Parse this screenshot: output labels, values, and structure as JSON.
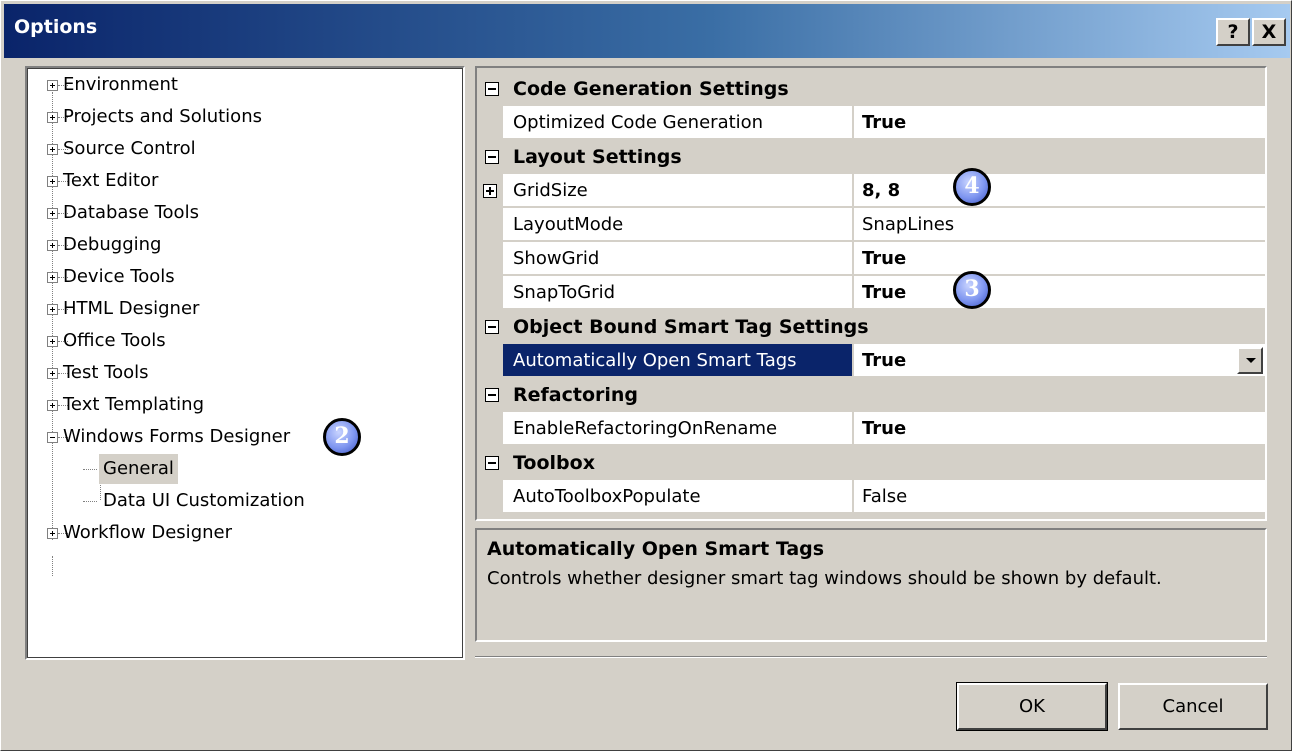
{
  "window": {
    "title": "Options"
  },
  "titlebar": {
    "help_label": "?",
    "close_label": "X"
  },
  "tree": {
    "items": [
      {
        "label": "Environment"
      },
      {
        "label": "Projects and Solutions"
      },
      {
        "label": "Source Control"
      },
      {
        "label": "Text Editor"
      },
      {
        "label": "Database Tools"
      },
      {
        "label": "Debugging"
      },
      {
        "label": "Device Tools"
      },
      {
        "label": "HTML Designer"
      },
      {
        "label": "Office Tools"
      },
      {
        "label": "Test Tools"
      },
      {
        "label": "Text Templating"
      },
      {
        "label": "Windows Forms Designer"
      },
      {
        "label": "General"
      },
      {
        "label": "Data UI Customization"
      },
      {
        "label": "Workflow Designer"
      }
    ],
    "selected": "General"
  },
  "badges": {
    "b2": "2",
    "b3": "3",
    "b4": "4"
  },
  "grid": {
    "categories": [
      {
        "label": "Code Generation Settings",
        "props": [
          {
            "name": "Optimized Code Generation",
            "value": "True"
          }
        ]
      },
      {
        "label": "Layout Settings",
        "props": [
          {
            "name": "GridSize",
            "value": "8, 8"
          },
          {
            "name": "LayoutMode",
            "value": "SnapLines"
          },
          {
            "name": "ShowGrid",
            "value": "True"
          },
          {
            "name": "SnapToGrid",
            "value": "True"
          }
        ]
      },
      {
        "label": "Object Bound Smart Tag Settings",
        "props": [
          {
            "name": "Automatically Open Smart Tags",
            "value": "True"
          }
        ]
      },
      {
        "label": "Refactoring",
        "props": [
          {
            "name": "EnableRefactoringOnRename",
            "value": "True"
          }
        ]
      },
      {
        "label": "Toolbox",
        "props": [
          {
            "name": "AutoToolboxPopulate",
            "value": "False"
          }
        ]
      }
    ]
  },
  "description": {
    "title": "Automatically Open Smart Tags",
    "text": "Controls whether designer smart tag windows should be shown by default."
  },
  "buttons": {
    "ok": "OK",
    "cancel": "Cancel"
  },
  "colors": {
    "titlebar_start": "#0a246a",
    "selection": "#0a246a",
    "face": "#d4d0c8",
    "badge": "#7f96f0"
  }
}
